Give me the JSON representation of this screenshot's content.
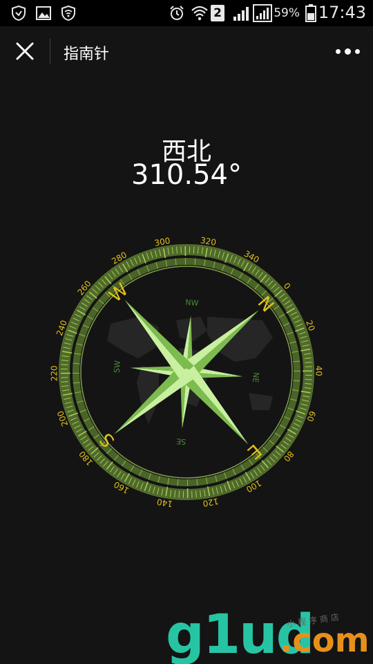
{
  "status_bar": {
    "battery_percent": "59%",
    "time": "17:43",
    "sim_slot": "2"
  },
  "nav": {
    "title": "指南针"
  },
  "heading": {
    "direction": "西北",
    "degrees": "310.54°"
  },
  "compass": {
    "heading_deg": 310.54,
    "bezel_numbers": [
      "0",
      "20",
      "40",
      "60",
      "80",
      "100",
      "120",
      "140",
      "160",
      "180",
      "200",
      "220",
      "240",
      "260",
      "280",
      "300",
      "320",
      "340"
    ],
    "cardinals": [
      "N",
      "E",
      "S",
      "W"
    ],
    "intercardinals": [
      "NE",
      "SE",
      "SW",
      "NW"
    ],
    "colors": {
      "bezel": "#5f7a35",
      "bezel_ticks": "#a9c95c",
      "numbers": "#e3c21a",
      "rose_light": "#c8f0a0",
      "rose_dark": "#7dbb4e",
      "intercardinal_text": "#4c8a3a",
      "map": "#262626"
    }
  },
  "watermark": {
    "logo_text": "g1ud",
    "domain_text": ".com",
    "tagline": "小程序商店",
    "colors": {
      "logo": "#27c4a4",
      "domain": "#e6901c"
    }
  }
}
